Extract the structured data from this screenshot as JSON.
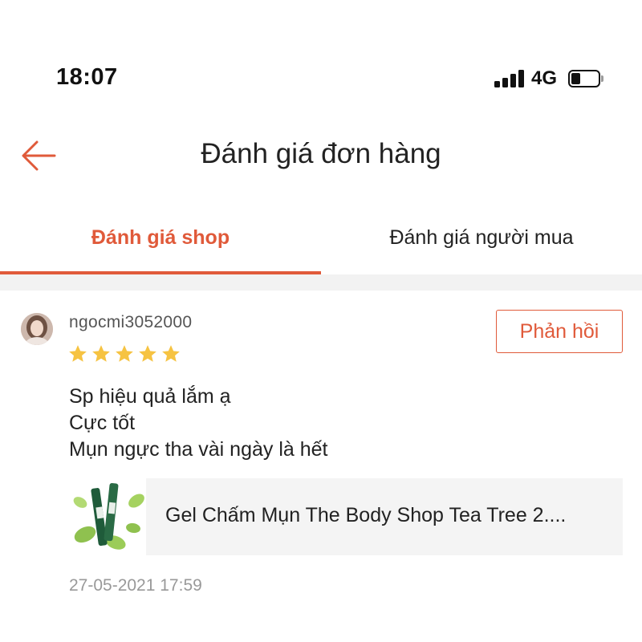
{
  "status_bar": {
    "time": "18:07",
    "network": "4G",
    "battery_level": 0.35
  },
  "header": {
    "title": "Đánh giá đơn hàng",
    "back_icon": "arrow-left-icon"
  },
  "tabs": [
    {
      "label": "Đánh giá shop",
      "active": true
    },
    {
      "label": "Đánh giá người mua",
      "active": false
    }
  ],
  "review": {
    "username": "ngocmi3052000",
    "rating": 5,
    "reply_label": "Phản hồi",
    "text_lines": [
      "Sp hiệu quả lắm ạ",
      "Cực tốt",
      "Mụn ngực tha vài ngày là hết"
    ],
    "product": {
      "name": "Gel Chấm Mụn The Body Shop Tea Tree 2...."
    },
    "date": "27-05-2021 17:59"
  },
  "colors": {
    "accent": "#e05a3a",
    "star": "#f6c342",
    "text": "#222222",
    "muted": "#999999"
  }
}
